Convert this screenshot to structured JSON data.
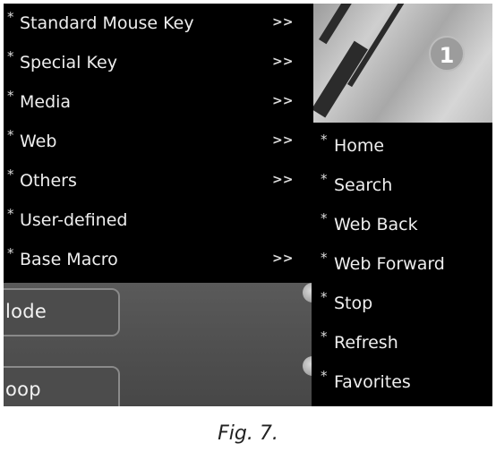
{
  "main_menu": {
    "items": [
      {
        "label": "Standard Mouse Key",
        "arrow": ">>"
      },
      {
        "label": "Special Key",
        "arrow": ">>"
      },
      {
        "label": "Media",
        "arrow": ">>"
      },
      {
        "label": "Web",
        "arrow": ">>"
      },
      {
        "label": "Others",
        "arrow": ">>"
      },
      {
        "label": "User-defined",
        "arrow": ""
      },
      {
        "label": "Base Macro",
        "arrow": ">>"
      }
    ],
    "bullet": "*"
  },
  "web_submenu": {
    "items": [
      {
        "label": "Home"
      },
      {
        "label": "Search"
      },
      {
        "label": "Web Back"
      },
      {
        "label": "Web Forward"
      },
      {
        "label": "Stop"
      },
      {
        "label": "Refresh"
      },
      {
        "label": "Favorites"
      }
    ]
  },
  "background": {
    "mode_label": "lode",
    "loop_label": "oop"
  },
  "mouse_image": {
    "badge": "1"
  },
  "caption": "Fig. 7."
}
